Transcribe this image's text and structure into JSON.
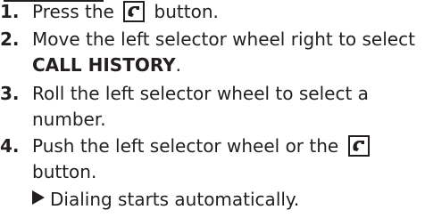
{
  "steps": [
    {
      "num": "1",
      "before": "Press the",
      "after": "button."
    },
    {
      "num": "2",
      "text": "Move the left selector wheel right to select",
      "cont_bold": "CALL HISTORY",
      "cont_after": "."
    },
    {
      "num": "3",
      "text": "Roll the left selector wheel to select a",
      "cont": "number."
    },
    {
      "num": "4",
      "text": "Push the left selector wheel or the",
      "cont": "button."
    }
  ],
  "result": "Dialing starts automatically.",
  "icons": {
    "phone_button": "phone-handset-icon",
    "result_marker": "triangle-right-icon"
  },
  "colors": {
    "text": "#231f20"
  }
}
